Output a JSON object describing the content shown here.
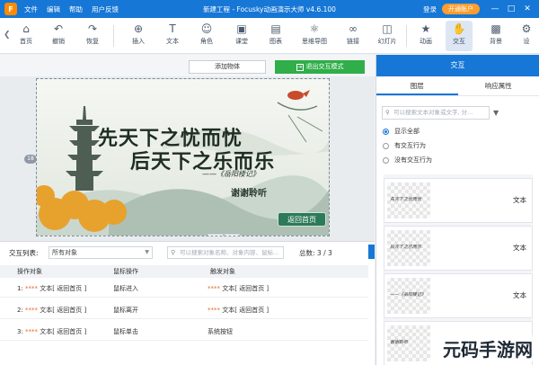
{
  "app": {
    "menu": [
      "文件",
      "编辑",
      "帮助",
      "用户反馈"
    ],
    "title": "新建工程 - Focusky动画演示大师 v4.6.100",
    "login": "登录",
    "open_account": "开通账户",
    "logo_letter": "F"
  },
  "toolbar": {
    "items": [
      {
        "label": "首页",
        "icon": "home-icon"
      },
      {
        "label": "撤销",
        "icon": "undo-icon"
      },
      {
        "label": "恢复",
        "icon": "redo-icon"
      },
      {
        "label": "插入",
        "icon": "plus-icon"
      },
      {
        "label": "文本",
        "icon": "text-icon"
      },
      {
        "label": "角色",
        "icon": "person-icon"
      },
      {
        "label": "课堂",
        "icon": "classroom-icon"
      },
      {
        "label": "图表",
        "icon": "chart-icon"
      },
      {
        "label": "思维导图",
        "icon": "mindmap-icon"
      },
      {
        "label": "链接",
        "icon": "link-icon"
      },
      {
        "label": "幻灯片",
        "icon": "slides-icon"
      },
      {
        "label": "动画",
        "icon": "animation-icon"
      },
      {
        "label": "交互",
        "icon": "interaction-icon"
      },
      {
        "label": "背景",
        "icon": "background-icon"
      },
      {
        "label": "设",
        "icon": "settings-icon"
      }
    ]
  },
  "subbar": {
    "add_object": "添加物体",
    "exit_mode": "退出交互模式"
  },
  "canvas": {
    "page_badge": "18",
    "line1": "先天下之忧而忧",
    "line2": "后天下之乐而乐",
    "source": "——《岳阳楼记》",
    "thanks": "谢谢聆听",
    "home_button": "返回首页",
    "collapse": "^"
  },
  "list": {
    "label": "交互列表:",
    "filter_value": "所有对象",
    "search_placeholder": "可以搜索对象名称、对象内容、鼠标...",
    "total": "总数: 3 / 3",
    "headers": [
      "操作对象",
      "鼠标操作",
      "触发对象"
    ],
    "rows": [
      {
        "index": "1:",
        "target": "文本[ 返回首页 ]",
        "action": "鼠标进入",
        "trigger": "文本[ 返回首页 ]"
      },
      {
        "index": "2:",
        "target": "文本[ 返回首页 ]",
        "action": "鼠标离开",
        "trigger": "文本[ 返回首页 ]"
      },
      {
        "index": "3:",
        "target": "文本[ 返回首页 ]",
        "action": "鼠标单击",
        "trigger": "系统按钮"
      }
    ],
    "dots": "****"
  },
  "right_panel": {
    "title": "交互",
    "tabs": [
      "图层",
      "响应属性"
    ],
    "search_placeholder": "可以搜索文本对象或文字, 分...",
    "radios": [
      {
        "label": "显示全部",
        "checked": true
      },
      {
        "label": "有交互行为",
        "checked": false
      },
      {
        "label": "没有交互行为",
        "checked": false
      }
    ],
    "layers": [
      {
        "thumb_text": "先天下之忧而忧",
        "label": "文本"
      },
      {
        "thumb_text": "后天下之乐而乐",
        "label": "文本"
      },
      {
        "thumb_text": "——《岳阳楼记》",
        "label": "文本"
      },
      {
        "thumb_text": "谢谢聆听",
        "label": ""
      }
    ]
  },
  "watermark": "元码手游网"
}
